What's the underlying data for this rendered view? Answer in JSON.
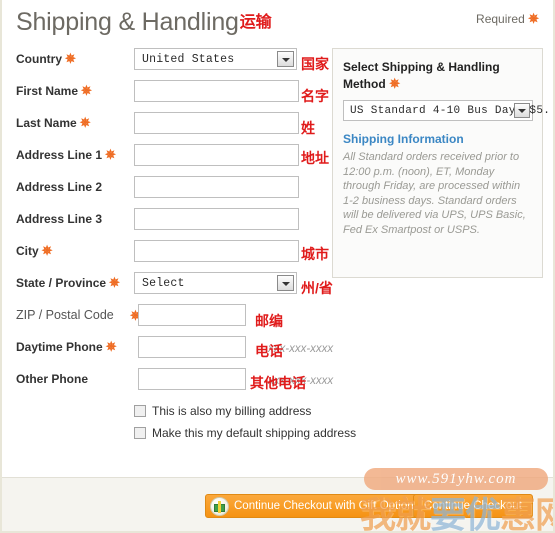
{
  "header": {
    "title": "Shipping & Handling",
    "title_cn": "运输",
    "required_label": "Required",
    "asterisk": "✻"
  },
  "form": {
    "rows": [
      {
        "label": "Country",
        "required": true,
        "cn": "国家",
        "type": "select",
        "value": "United States"
      },
      {
        "label": "First Name",
        "required": true,
        "cn": "名字",
        "type": "text",
        "value": ""
      },
      {
        "label": "Last Name",
        "required": true,
        "cn": "姓",
        "type": "text",
        "value": ""
      },
      {
        "label": "Address Line 1",
        "required": true,
        "cn": "地址",
        "type": "text",
        "value": ""
      },
      {
        "label": "Address Line 2",
        "required": false,
        "cn": "",
        "type": "text",
        "value": ""
      },
      {
        "label": "Address Line 3",
        "required": false,
        "cn": "",
        "type": "text",
        "value": ""
      },
      {
        "label": "City",
        "required": true,
        "cn": "城市",
        "type": "text",
        "value": ""
      },
      {
        "label": "State / Province",
        "required": true,
        "cn": "州/省",
        "type": "select",
        "value": "Select"
      },
      {
        "label": "ZIP / Postal Code",
        "required": true,
        "cn": "邮编",
        "type": "text",
        "value": ""
      },
      {
        "label": "Daytime Phone",
        "required": true,
        "cn": "电话",
        "type": "text",
        "value": "",
        "hint": "xxx-xxx-xxxx"
      },
      {
        "label": "Other Phone",
        "required": false,
        "cn": "其他电话",
        "type": "text",
        "value": "",
        "hint": "xxx-xxx-xxxx"
      }
    ],
    "labels": {
      "country": "Country",
      "first_name": "First Name",
      "last_name": "Last Name",
      "address1": "Address Line 1",
      "address2": "Address Line 2",
      "address3": "Address Line 3",
      "city": "City",
      "state": "State / Province",
      "zip": "ZIP / Postal Code",
      "daytime_phone": "Daytime Phone",
      "other_phone": "Other Phone"
    },
    "cn": {
      "country": "国家",
      "first_name": "名字",
      "last_name": "姓",
      "address1": "地址",
      "city": "城市",
      "state": "州/省",
      "zip": "邮编",
      "daytime_phone": "电话",
      "other_phone": "其他电话"
    },
    "values": {
      "country": "United States",
      "state": "Select"
    },
    "hints": {
      "daytime_phone": "xxx-xxx-xxxx",
      "other_phone": "xxx-xxx-xxxx"
    }
  },
  "checkboxes": [
    {
      "label": "This is also my billing address",
      "checked": false
    },
    {
      "label": "Make this my default shipping address",
      "checked": false
    }
  ],
  "shipping_panel": {
    "heading": "Select Shipping & Handling Method",
    "method_value": "US Standard 4-10 Bus Days $5.",
    "info_link": "Shipping Information",
    "info_text": "All Standard orders received prior to 12:00 p.m. (noon), ET, Monday through Friday, are processed within 1-2 business days. Standard orders will be delivered via UPS, UPS Basic, Fed Ex Smartpost or USPS."
  },
  "footer": {
    "gift_button_label": "Continue Checkout with Gift Options",
    "checkout_button_label": "Continue Checkout"
  },
  "watermark": {
    "url": "www.591yhw.com",
    "cn_part1": "我就",
    "cn_part2": "要优",
    "cn_part3": "惠网"
  },
  "colors": {
    "accent_orange": "#ef6c23",
    "annotation_red": "#e01b1b",
    "link_blue": "#3b87c4",
    "button_orange": "#f59313"
  }
}
